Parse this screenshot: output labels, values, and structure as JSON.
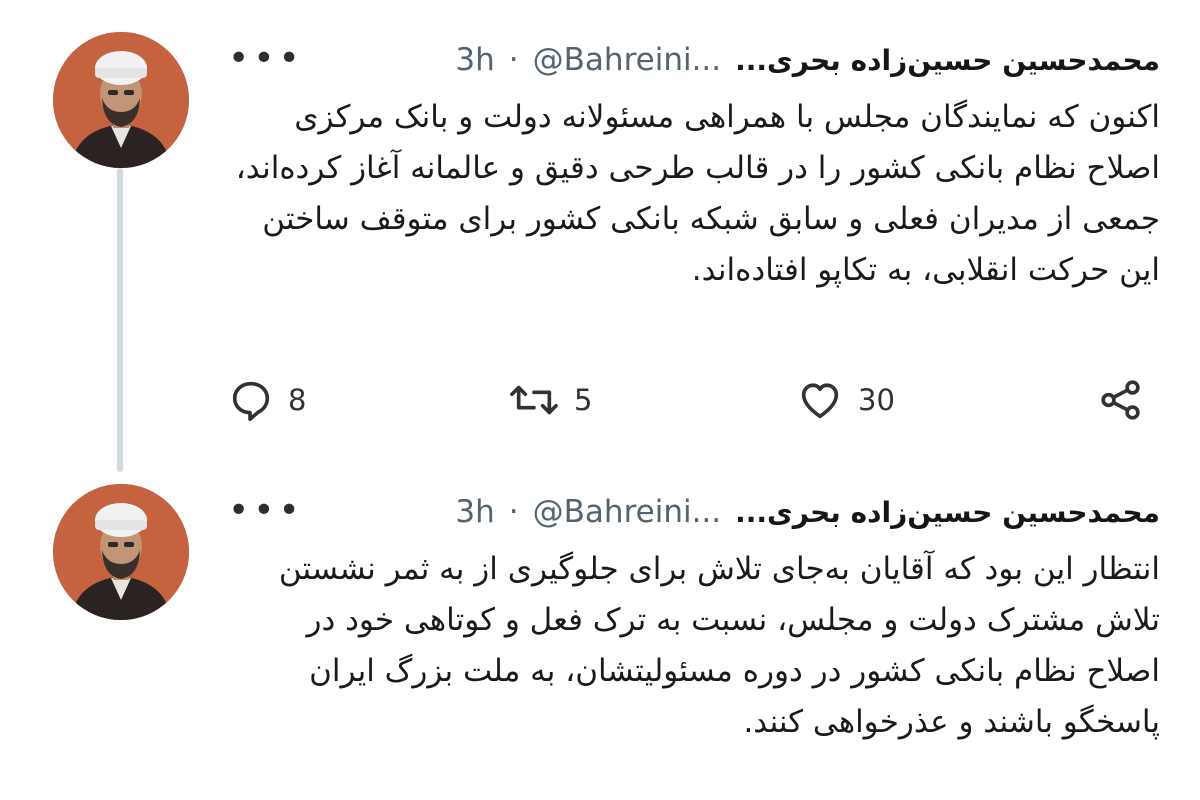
{
  "tweets": [
    {
      "author": {
        "display_name": "محمدحسین حسین‌زاده بحری...",
        "handle": "@Bahreini...",
        "avatar_icon": "profile-photo"
      },
      "separator": "·",
      "time": "3h",
      "more_icon": "•••",
      "text": "اکنون که نمایندگان مجلس با همراهی مسئولانه دولت و بانک مرکزی اصلاح نظام بانکی کشور را در قالب طرحی دقیق و عالمانه آغاز کرده‌اند، جمعی از مدیران فعلی و سابق شبکه بانکی کشور برای متوقف ساختن این حرکت انقلابی، به تکاپو افتاده‌اند.",
      "replies": "8",
      "retweets": "5",
      "likes": "30"
    },
    {
      "author": {
        "display_name": "محمدحسین حسین‌زاده بحری...",
        "handle": "@Bahreini...",
        "avatar_icon": "profile-photo"
      },
      "separator": "·",
      "time": "3h",
      "more_icon": "•••",
      "text": "انتظار این بود که آقایان به‌جای تلاش برای جلوگیری از به ثمر نشستن تلاش مشترک دولت و مجلس، نسبت به ترک فعل و کوتاهی خود در اصلاح نظام بانکی کشور در دوره مسئولیتشان، به ملت بزرگ ایران پاسخگو باشند و عذرخواهی کنند."
    }
  ],
  "colors": {
    "avatar_bg": "#c5623f",
    "thread_line": "#cfd9de",
    "muted_text": "#536471"
  }
}
